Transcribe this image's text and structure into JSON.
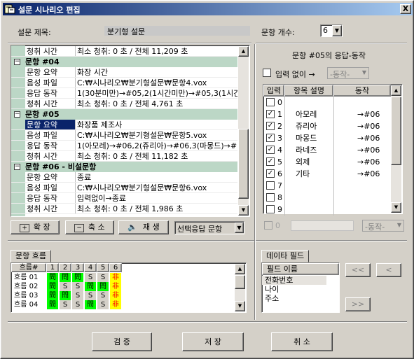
{
  "window": {
    "title": "설문 시나리오 편집",
    "close": "X"
  },
  "header": {
    "title_label": "설문 제목:",
    "title_value": "분기형 설문",
    "count_label": "문항 개수:",
    "count_value": "6"
  },
  "props": [
    {
      "type": "kv",
      "k": "청취 시간",
      "v": "최소 청취: 0 초 / 전체 11,209 초"
    },
    {
      "type": "grp",
      "v": "문항 #04"
    },
    {
      "type": "kv",
      "k": "문항 요약",
      "v": "화장 시간"
    },
    {
      "type": "kv",
      "k": "음성 파일",
      "v": "C:₩시나리오₩분기형설문₩문항4.vox"
    },
    {
      "type": "kv",
      "k": "응답 동작",
      "v": "1(30분미만)→#05,2(1시간미만)→#05,3(1시간"
    },
    {
      "type": "kv",
      "k": "청취 시간",
      "v": "최소 청취: 0 초 / 전체 4,761 초"
    },
    {
      "type": "grp",
      "v": "문항 #05"
    },
    {
      "type": "kv",
      "k": "문항 요약",
      "v": "화장품 제조사",
      "sel": true
    },
    {
      "type": "kv",
      "k": "음성 파일",
      "v": "C:₩시나리오₩분기형설문₩문항5.vox"
    },
    {
      "type": "kv",
      "k": "응답 동작",
      "v": "1(아모레)→#06,2(쥬리아)→#06,3(마몽드)→#"
    },
    {
      "type": "kv",
      "k": "청취 시간",
      "v": "최소 청취: 0 초 / 전체 11,182 초"
    },
    {
      "type": "grp",
      "v": "문항 #06 - 비설문항"
    },
    {
      "type": "kv",
      "k": "문항 요약",
      "v": "종료"
    },
    {
      "type": "kv",
      "k": "음성 파일",
      "v": "C:₩시나리오₩분기형설문₩문항6.vox"
    },
    {
      "type": "kv",
      "k": "응답 동작",
      "v": "입력없이→종료"
    },
    {
      "type": "kv",
      "k": "청취 시간",
      "v": "최소 청취: 0 초 / 전체 1,986 초"
    }
  ],
  "toolbar": {
    "expand": "확 장",
    "collapse": "축 소",
    "play": "재 생",
    "select_label": "선택응답 문항"
  },
  "response": {
    "title": "문항 #05의 응답-동작",
    "no_input_label": "입력 없이 →",
    "action_placeholder": "-동작-",
    "columns": [
      "입력",
      "항목 설명",
      "동작"
    ],
    "rows": [
      {
        "n": "0",
        "checked": false,
        "desc": "",
        "act": ""
      },
      {
        "n": "1",
        "checked": true,
        "desc": "아모레",
        "act": "→#06"
      },
      {
        "n": "2",
        "checked": true,
        "desc": "쥬리아",
        "act": "→#06"
      },
      {
        "n": "3",
        "checked": true,
        "desc": "마몽드",
        "act": "→#06"
      },
      {
        "n": "4",
        "checked": true,
        "desc": "라네즈",
        "act": "→#06"
      },
      {
        "n": "5",
        "checked": true,
        "desc": "외제",
        "act": "→#06"
      },
      {
        "n": "6",
        "checked": true,
        "desc": "기타",
        "act": "→#06"
      },
      {
        "n": "7",
        "checked": false,
        "desc": "",
        "act": ""
      },
      {
        "n": "8",
        "checked": false,
        "desc": "",
        "act": ""
      },
      {
        "n": "9",
        "checked": false,
        "desc": "",
        "act": ""
      }
    ],
    "bottom_index": "0",
    "bottom_action": "-동작-"
  },
  "flow": {
    "tab": "문항 흐름",
    "columns": [
      "흐름#",
      "1",
      "2",
      "3",
      "4",
      "5",
      "6"
    ],
    "rows": [
      {
        "name": "흐름 01",
        "cells": [
          "問",
          "問",
          "問",
          "S",
          "S",
          "非"
        ]
      },
      {
        "name": "흐름 02",
        "cells": [
          "問",
          "S",
          "S",
          "問",
          "問",
          "非"
        ]
      },
      {
        "name": "흐름 03",
        "cells": [
          "問",
          "問",
          "S",
          "S",
          "S",
          "非"
        ]
      },
      {
        "name": "흐름 04",
        "cells": [
          "問",
          "S",
          "S",
          "問",
          "S",
          "非"
        ]
      }
    ],
    "colors": {
      "問": "#00ff00",
      "S": "#d4d0c8",
      "非": "#ffff00"
    }
  },
  "datafield": {
    "tab": "데이타 필드",
    "header": "필드 이름",
    "items": [
      "전화번호",
      "나이",
      "주소"
    ],
    "btn_all_left": "<<",
    "btn_left": "<",
    "btn_all_right": ">>"
  },
  "footer": {
    "verify": "검 증",
    "save": "저 장",
    "cancel": "취 소"
  }
}
